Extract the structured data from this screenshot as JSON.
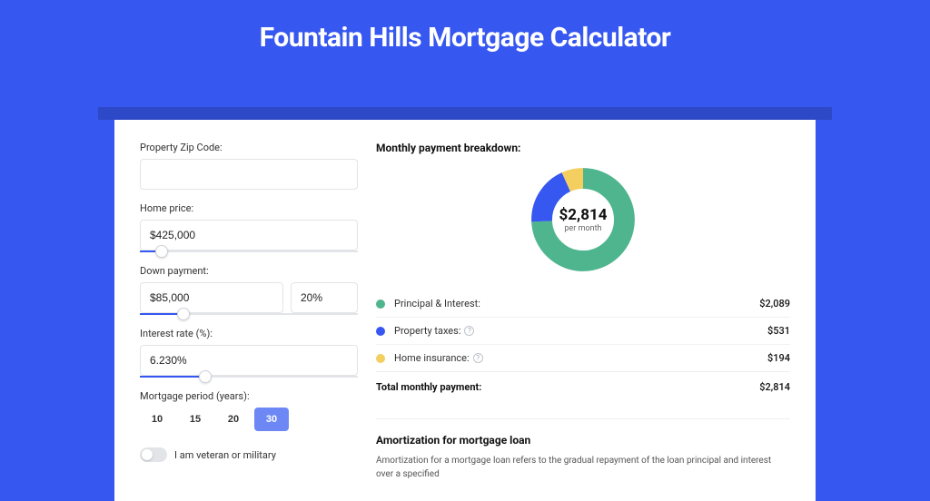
{
  "title": "Fountain Hills Mortgage Calculator",
  "form": {
    "zip_label": "Property Zip Code:",
    "zip_value": "",
    "home_price_label": "Home price:",
    "home_price_value": "$425,000",
    "down_payment_label": "Down payment:",
    "down_payment_value": "$85,000",
    "down_payment_pct": "20%",
    "interest_rate_label": "Interest rate (%):",
    "interest_rate_value": "6.230%",
    "period_label": "Mortgage period (years):",
    "periods": [
      "10",
      "15",
      "20",
      "30"
    ],
    "period_selected": "30",
    "veteran_label": "I am veteran or military"
  },
  "breakdown": {
    "header": "Monthly payment breakdown:",
    "center_amount": "$2,814",
    "center_sub": "per month",
    "items": [
      {
        "label": "Principal & Interest:",
        "value": "$2,089",
        "color": "#4eb58f",
        "help": false
      },
      {
        "label": "Property taxes:",
        "value": "$531",
        "color": "#3657f0",
        "help": true
      },
      {
        "label": "Home insurance:",
        "value": "$194",
        "color": "#f4ce5e",
        "help": true
      }
    ],
    "total_label": "Total monthly payment:",
    "total_value": "$2,814"
  },
  "amortization": {
    "title": "Amortization for mortgage loan",
    "text": "Amortization for a mortgage loan refers to the gradual repayment of the loan principal and interest over a specified"
  },
  "chart_data": {
    "type": "pie",
    "title": "Monthly payment breakdown",
    "categories": [
      "Principal & Interest",
      "Property taxes",
      "Home insurance"
    ],
    "values": [
      2089,
      531,
      194
    ],
    "colors": [
      "#4eb58f",
      "#3657f0",
      "#f4ce5e"
    ],
    "total": 2814,
    "center_label": "$2,814 per month"
  }
}
